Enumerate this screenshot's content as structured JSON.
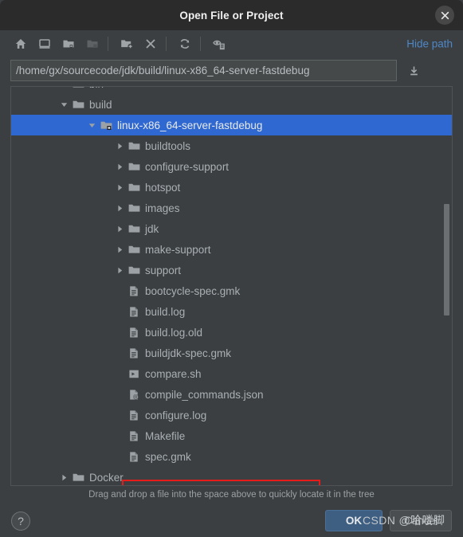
{
  "window": {
    "title": "Open File or Project",
    "close_icon": "close-icon"
  },
  "toolbar": {
    "icons": [
      {
        "name": "home-icon",
        "title": "Home",
        "disabled": false
      },
      {
        "name": "desktop-icon",
        "title": "Desktop",
        "disabled": false
      },
      {
        "name": "project-folder-icon",
        "title": "Project Directory",
        "disabled": false
      },
      {
        "name": "module-folder-icon",
        "title": "Module Directory",
        "disabled": true
      },
      {
        "name": "new-folder-icon",
        "title": "New Folder",
        "disabled": false
      },
      {
        "name": "delete-icon",
        "title": "Delete",
        "disabled": false
      },
      {
        "name": "refresh-icon",
        "title": "Refresh",
        "disabled": false
      },
      {
        "name": "show-hidden-icon",
        "title": "Show Hidden Files",
        "disabled": false
      }
    ],
    "hide_path_label": "Hide path"
  },
  "path": {
    "value": "/home/gx/sourcecode/jdk/build/linux-x86_64-server-fastdebug",
    "placeholder": "",
    "dropdown_icon": "download-arrow-icon"
  },
  "tree": {
    "rows": [
      {
        "label": "bin",
        "indent": 1,
        "type": "folder",
        "arrow": "collapsed",
        "selected": false,
        "partial": true
      },
      {
        "label": "build",
        "indent": 1,
        "type": "folder",
        "arrow": "expanded",
        "selected": false
      },
      {
        "label": "linux-x86_64-server-fastdebug",
        "indent": 2,
        "type": "folder-module",
        "arrow": "expanded",
        "selected": true
      },
      {
        "label": "buildtools",
        "indent": 3,
        "type": "folder",
        "arrow": "collapsed",
        "selected": false
      },
      {
        "label": "configure-support",
        "indent": 3,
        "type": "folder",
        "arrow": "collapsed",
        "selected": false
      },
      {
        "label": "hotspot",
        "indent": 3,
        "type": "folder",
        "arrow": "collapsed",
        "selected": false
      },
      {
        "label": "images",
        "indent": 3,
        "type": "folder",
        "arrow": "collapsed",
        "selected": false
      },
      {
        "label": "jdk",
        "indent": 3,
        "type": "folder",
        "arrow": "collapsed",
        "selected": false
      },
      {
        "label": "make-support",
        "indent": 3,
        "type": "folder",
        "arrow": "collapsed",
        "selected": false
      },
      {
        "label": "support",
        "indent": 3,
        "type": "folder",
        "arrow": "collapsed",
        "selected": false
      },
      {
        "label": "bootcycle-spec.gmk",
        "indent": 3,
        "type": "file",
        "arrow": "none",
        "selected": false
      },
      {
        "label": "build.log",
        "indent": 3,
        "type": "file",
        "arrow": "none",
        "selected": false
      },
      {
        "label": "build.log.old",
        "indent": 3,
        "type": "file",
        "arrow": "none",
        "selected": false
      },
      {
        "label": "buildjdk-spec.gmk",
        "indent": 3,
        "type": "file",
        "arrow": "none",
        "selected": false
      },
      {
        "label": "compare.sh",
        "indent": 3,
        "type": "script",
        "arrow": "none",
        "selected": false
      },
      {
        "label": "compile_commands.json",
        "indent": 3,
        "type": "json",
        "arrow": "none",
        "selected": false,
        "annotated": true
      },
      {
        "label": "configure.log",
        "indent": 3,
        "type": "file",
        "arrow": "none",
        "selected": false
      },
      {
        "label": "Makefile",
        "indent": 3,
        "type": "file",
        "arrow": "none",
        "selected": false
      },
      {
        "label": "spec.gmk",
        "indent": 3,
        "type": "file",
        "arrow": "none",
        "selected": false
      },
      {
        "label": "Docker",
        "indent": 1,
        "type": "folder",
        "arrow": "collapsed",
        "selected": false,
        "partial": true
      }
    ],
    "scrollbar": {
      "name": "vertical-scrollbar"
    }
  },
  "hint": {
    "text": "Drag and drop a file into the space above to quickly locate it in the tree"
  },
  "footer": {
    "help_label": "?",
    "ok_label": "OK",
    "cancel_label": "Cancel"
  },
  "watermark": {
    "text": "CSDN @哈喽脚"
  },
  "colors": {
    "titlebar": "#2b2b2b",
    "dialog_bg": "#3c3f41",
    "selection_blue": "#2f68d0",
    "link_blue": "#4e87c7",
    "annotation_red": "#e81b1b",
    "text": "#a9b0b4",
    "ok_button": "#3f5f82"
  }
}
